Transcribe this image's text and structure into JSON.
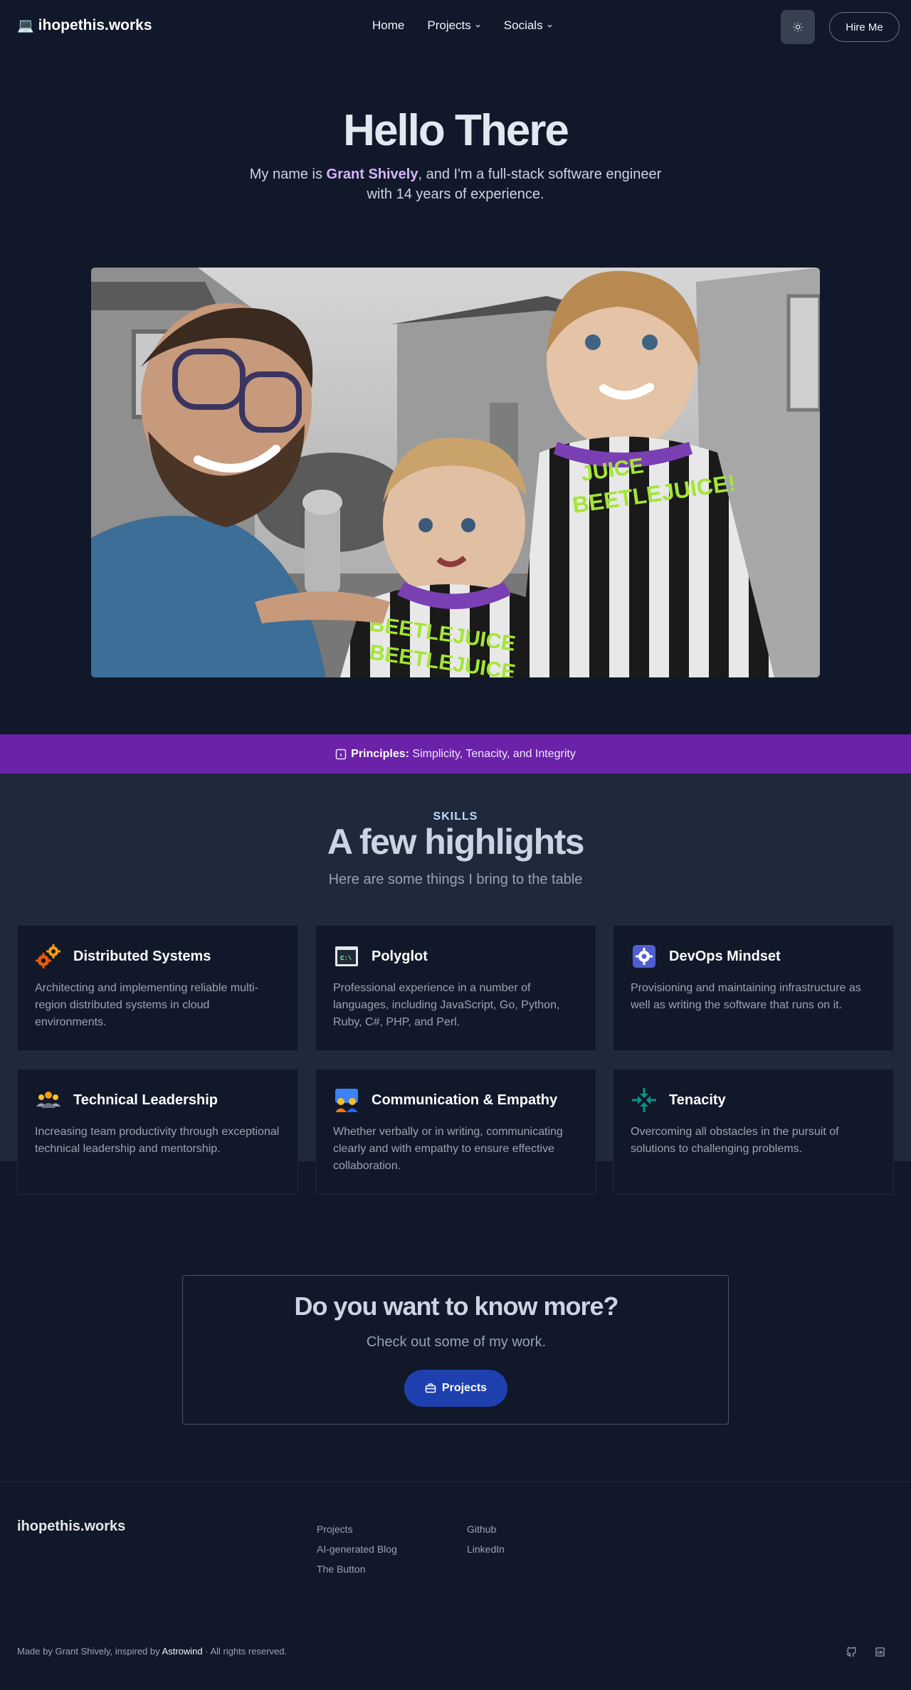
{
  "header": {
    "brand_emoji": "💻",
    "brand": "ihopethis.works",
    "nav": [
      {
        "label": "Home",
        "has_dropdown": false
      },
      {
        "label": "Projects",
        "has_dropdown": true
      },
      {
        "label": "Socials",
        "has_dropdown": true
      }
    ],
    "theme_icon": "sun-icon",
    "hire_label": "Hire Me"
  },
  "hero": {
    "title": "Hello There",
    "intro_prefix": "My name is ",
    "name": "Grant Shively",
    "intro_suffix": ", and I'm a full-stack software engineer with 14 years of experience.",
    "photo_text_small": "BEETLEJUICE",
    "photo_text_large": "BEETLEJUICE!",
    "photo_text_small_top": "JUICE"
  },
  "principles": {
    "icon": "info-square-icon",
    "label": "Principles:",
    "text": " Simplicity, Tenacity, and Integrity"
  },
  "skills": {
    "eyebrow": "SKILLS",
    "title": "A few highlights",
    "subtitle": "Here are some things I bring to the table",
    "cards": [
      {
        "icon": "gears-icon",
        "title": "Distributed Systems",
        "desc": "Architecting and implementing reliable multi-region distributed systems in cloud environments."
      },
      {
        "icon": "terminal-icon",
        "title": "Polyglot",
        "desc": "Professional experience in a number of languages, including JavaScript, Go, Python, Ruby, C#, PHP, and Perl.",
        "icon_text": "C:\\"
      },
      {
        "icon": "gear-badge-icon",
        "title": "DevOps Mindset",
        "desc": "Provisioning and maintaining infrastructure as well as writing the software that runs on it."
      },
      {
        "icon": "team-icon",
        "title": "Technical Leadership",
        "desc": "Increasing team productivity through exceptional technical leadership and mentorship."
      },
      {
        "icon": "conversation-icon",
        "title": "Communication & Empathy",
        "desc": "Whether verbally or in writing, communicating clearly and with empathy to ensure effective collaboration."
      },
      {
        "icon": "arrows-inward-icon",
        "title": "Tenacity",
        "desc": "Overcoming all obstacles in the pursuit of solutions to challenging problems."
      }
    ]
  },
  "cta": {
    "title": "Do you want to know more?",
    "subtitle": "Check out some of my work.",
    "button_icon": "briefcase-icon",
    "button_label": "Projects"
  },
  "footer": {
    "brand": "ihopethis.works",
    "col1": [
      "Projects",
      "AI-generated Blog",
      "The Button"
    ],
    "col2": [
      "Github",
      "LinkedIn"
    ],
    "made_by": "Made by Grant Shively, inspired by ",
    "inspired": "Astrowind",
    "rights": " · All rights reserved.",
    "social_icons": [
      "github-icon",
      "linkedin-icon"
    ]
  },
  "colors": {
    "background": "#111829",
    "section_bg": "#1e293b",
    "accent_purple": "#6b21a8",
    "name_highlight": "#d8b4fe",
    "button_blue": "#1e40af"
  }
}
